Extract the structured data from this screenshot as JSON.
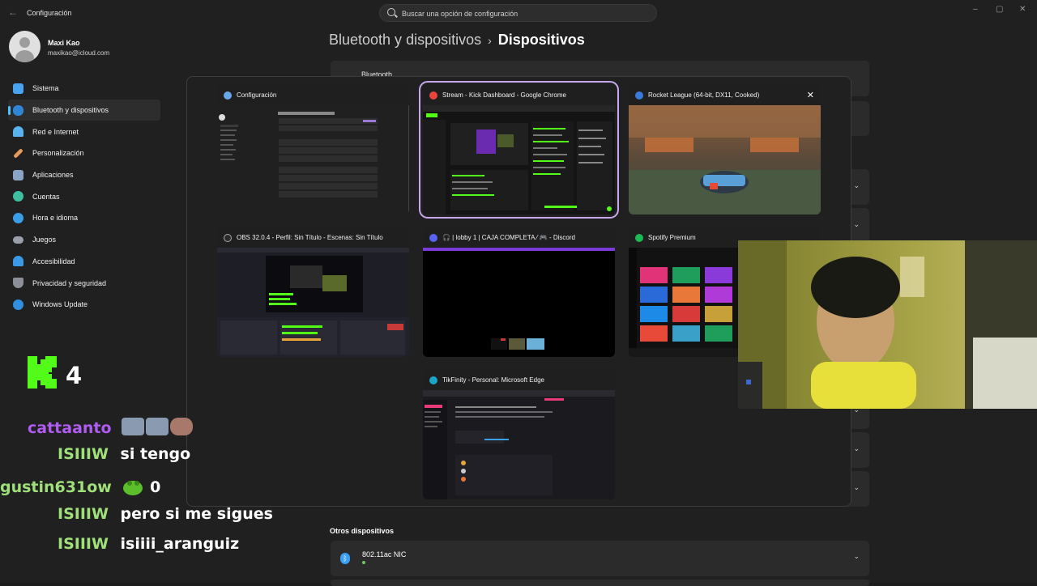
{
  "app": {
    "title": "Configuración",
    "back": "←",
    "search_placeholder": "Buscar una opción de configuración",
    "controls": [
      "–",
      "▢",
      "✕"
    ]
  },
  "profile": {
    "name": "Maxi Kao",
    "email": "maxikao@icloud.com"
  },
  "sidebar": {
    "items": [
      {
        "label": "Sistema",
        "icon": "system-icon",
        "color": "#4aa3f0"
      },
      {
        "label": "Bluetooth y dispositivos",
        "icon": "bluetooth-icon",
        "color": "#2f86d6",
        "active": true
      },
      {
        "label": "Red e Internet",
        "icon": "wifi-icon",
        "color": "#5ab2f0"
      },
      {
        "label": "Personalización",
        "icon": "brush-icon",
        "color": "#e89a5a"
      },
      {
        "label": "Aplicaciones",
        "icon": "apps-icon",
        "color": "#8aa4c4"
      },
      {
        "label": "Cuentas",
        "icon": "account-icon",
        "color": "#3fbfa0"
      },
      {
        "label": "Hora e idioma",
        "icon": "globe-icon",
        "color": "#3a9fe8"
      },
      {
        "label": "Juegos",
        "icon": "gamepad-icon",
        "color": "#9aa0a8"
      },
      {
        "label": "Accesibilidad",
        "icon": "accessibility-icon",
        "color": "#3a9ae8"
      },
      {
        "label": "Privacidad y seguridad",
        "icon": "shield-icon",
        "color": "#8a8f98"
      },
      {
        "label": "Windows Update",
        "icon": "update-icon",
        "color": "#2f8fe0"
      }
    ]
  },
  "main": {
    "breadcrumb_parent": "Bluetooth y dispositivos",
    "breadcrumb_sep": "›",
    "breadcrumb_current": "Dispositivos",
    "bluetooth_card_label": "Bluetooth",
    "other_devices_title": "Otros dispositivos",
    "device_name": "802.11ac NIC",
    "chevron": "⌄"
  },
  "switcher": {
    "windows": [
      {
        "title": "Configuración",
        "icon": "gear-icon",
        "icon_color": "#6aa7e8"
      },
      {
        "title": "Stream - Kick Dashboard - Google Chrome",
        "icon": "chrome-icon",
        "icon_color": "#e8453c",
        "selected": true
      },
      {
        "title": "Rocket League (64-bit, DX11, Cooked)",
        "icon": "rocket-league-icon",
        "icon_color": "#3a7ad8",
        "close": "✕"
      },
      {
        "title": "OBS 32.0.4 - Perfil: Sin Título - Escenas: Sin Título",
        "icon": "obs-icon",
        "icon_color": "#2b2b2b"
      },
      {
        "title": "🎧 | lobby 1 | CAJA COMPLETA ⁄ 🎮 - Discord",
        "icon": "discord-icon",
        "icon_color": "#5865f2"
      },
      {
        "title": "Spotify Premium",
        "icon": "spotify-icon",
        "icon_color": "#1db954"
      },
      {
        "title": "TikFinity - Personal: Microsoft Edge",
        "icon": "edge-icon",
        "icon_color": "#1ba6c9"
      }
    ]
  },
  "chat": {
    "viewer_count": "4",
    "messages": [
      {
        "user": "cattaanto",
        "text": "",
        "user_color": "#b05cf2"
      },
      {
        "user": "ISIIIW",
        "text": "si tengo",
        "user_color": "#9fe07a"
      },
      {
        "user": "gustin631ow",
        "text": "0",
        "user_color": "#9fe07a"
      },
      {
        "user": "ISIIIW",
        "text": "pero si me sigues",
        "user_color": "#9fe07a"
      },
      {
        "user": "ISIIIW",
        "text": "isiiii_aranguiz",
        "user_color": "#9fe07a"
      }
    ]
  }
}
